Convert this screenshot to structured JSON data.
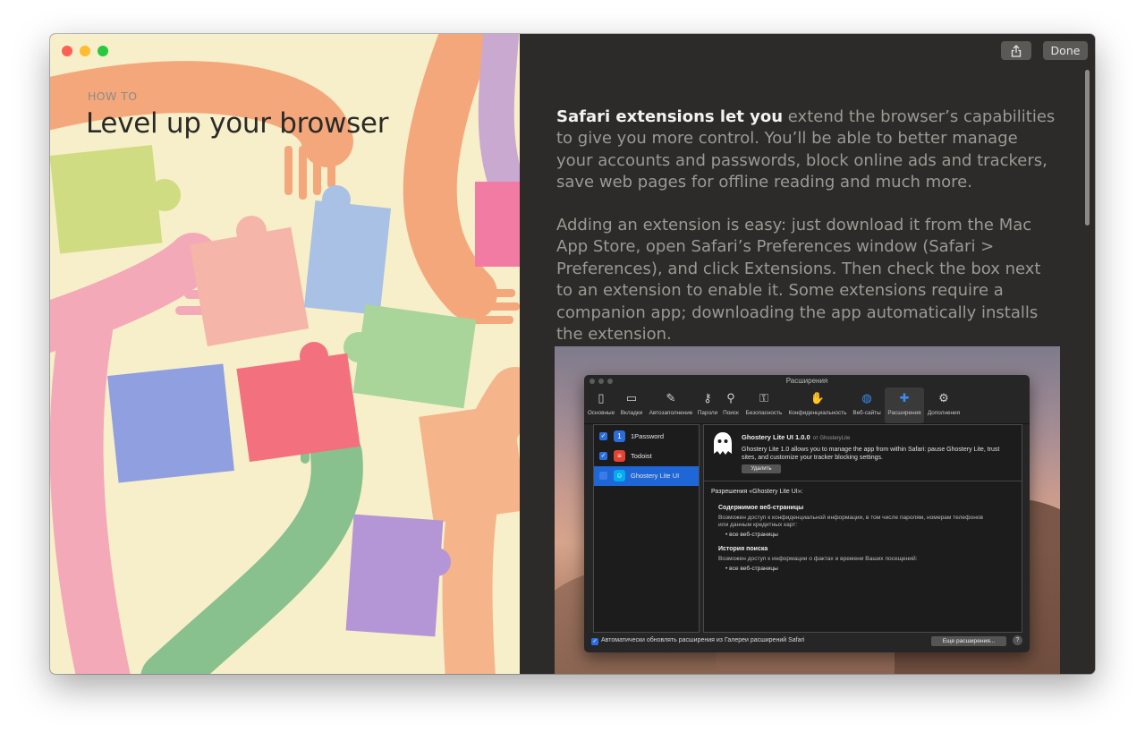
{
  "window": {
    "share_icon": "share-icon",
    "done_label": "Done"
  },
  "article": {
    "eyebrow": "HOW TO",
    "title": "Level up your browser",
    "p1_strong": "Safari extensions let you",
    "p1_rest": " extend the browser’s capabilities to give you more control. You’ll be able to better manage your accounts and passwords, block online ads and trackers, save web pages for offline reading and much more.",
    "p2": "Adding an extension is easy: just download it from the Mac App Store, open Safari’s Preferences window (Safari > Preferences), and click Extensions. Then check the box next to an extension to enable it. Some extensions require a companion app; downloading the app automatically installs the extension."
  },
  "prefs": {
    "title": "Расширения",
    "toolbar": [
      {
        "label": "Основные",
        "icon": "switch-icon"
      },
      {
        "label": "Вкладки",
        "icon": "tabs-icon"
      },
      {
        "label": "Автозаполнение",
        "icon": "pencil-icon"
      },
      {
        "label": "Пароли",
        "icon": "key-icon"
      },
      {
        "label": "Поиск",
        "icon": "magnifier-icon"
      },
      {
        "label": "Безопасность",
        "icon": "lock-icon"
      },
      {
        "label": "Конфиденциальность",
        "icon": "hand-icon"
      },
      {
        "label": "Веб-сайты",
        "icon": "globe-icon"
      },
      {
        "label": "Расширения",
        "icon": "puzzle-icon"
      },
      {
        "label": "Дополнения",
        "icon": "gear-icon"
      }
    ],
    "extensions": [
      {
        "name": "1Password",
        "icon": "1password-icon",
        "color": "#2a6fd8"
      },
      {
        "name": "Todoist",
        "icon": "todoist-icon",
        "color": "#e44332"
      },
      {
        "name": "Ghostery Lite UI",
        "icon": "ghostery-icon",
        "color": "#00aef0"
      }
    ],
    "detail": {
      "title": "Ghostery Lite UI 1.0.0",
      "by": "от GhosteryLite",
      "description": "Ghostery Lite 1.0 allows you to manage the app from within Safari: pause Ghostery Lite, trust sites, and customize your tracker blocking settings.",
      "remove_label": "Удалить",
      "permissions_title": "Разрешения «Ghostery Lite UI»:",
      "section1_heading": "Содержимое веб-страницы",
      "section1_text": "Возможен доступ к конфиденциальной информации, в том числе паролям, номерам телефонов или данным кредитных карт:",
      "section1_bullet": "• все веб-страницы",
      "section2_heading": "История поиска",
      "section2_text": "Возможен доступ к информации о фактах и времени Ваших посещений:",
      "section2_bullet": "• все веб-страницы"
    },
    "auto_update_label": "Автоматически обновлять расширения из Галереи расширений Safari",
    "more_label": "Еще расширения...",
    "help_label": "?"
  }
}
